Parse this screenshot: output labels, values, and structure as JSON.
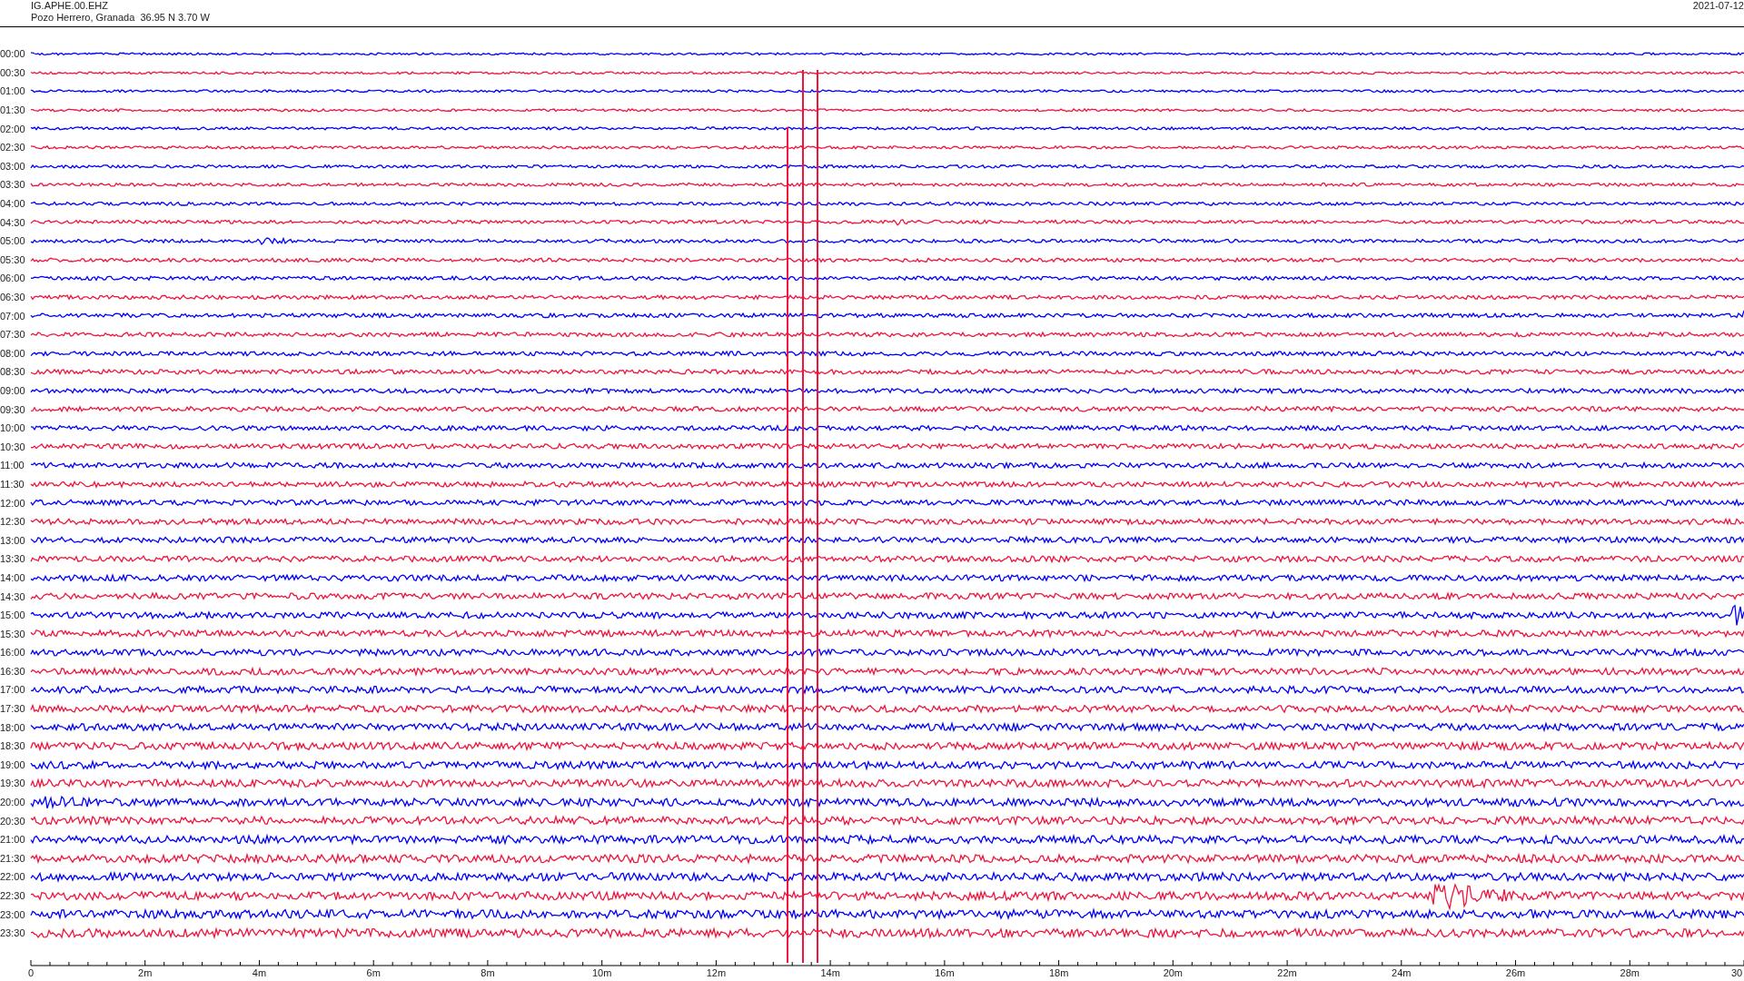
{
  "header": {
    "station": "IG.APHE.00.EHZ",
    "location": "Pozo Herrero, Granada  36.95 N 3.70 W",
    "date": "2021-07-12"
  },
  "rows": [
    {
      "time": "00:00",
      "color": "#0000ff"
    },
    {
      "time": "00:30",
      "color": "#f0143c"
    },
    {
      "time": "01:00",
      "color": "#0000ff"
    },
    {
      "time": "01:30",
      "color": "#f0143c"
    },
    {
      "time": "02:00",
      "color": "#0000ff"
    },
    {
      "time": "02:30",
      "color": "#f0143c"
    },
    {
      "time": "03:00",
      "color": "#0000ff"
    },
    {
      "time": "03:30",
      "color": "#f0143c"
    },
    {
      "time": "04:00",
      "color": "#0000ff"
    },
    {
      "time": "04:30",
      "color": "#f0143c"
    },
    {
      "time": "05:00",
      "color": "#0000ff"
    },
    {
      "time": "05:30",
      "color": "#f0143c"
    },
    {
      "time": "06:00",
      "color": "#0000ff"
    },
    {
      "time": "06:30",
      "color": "#f0143c"
    },
    {
      "time": "07:00",
      "color": "#0000ff"
    },
    {
      "time": "07:30",
      "color": "#f0143c"
    },
    {
      "time": "08:00",
      "color": "#0000ff"
    },
    {
      "time": "08:30",
      "color": "#f0143c"
    },
    {
      "time": "09:00",
      "color": "#0000ff"
    },
    {
      "time": "09:30",
      "color": "#f0143c"
    },
    {
      "time": "10:00",
      "color": "#0000ff"
    },
    {
      "time": "10:30",
      "color": "#f0143c"
    },
    {
      "time": "11:00",
      "color": "#0000ff"
    },
    {
      "time": "11:30",
      "color": "#f0143c"
    },
    {
      "time": "12:00",
      "color": "#0000ff"
    },
    {
      "time": "12:30",
      "color": "#f0143c"
    },
    {
      "time": "13:00",
      "color": "#0000ff"
    },
    {
      "time": "13:30",
      "color": "#f0143c"
    },
    {
      "time": "14:00",
      "color": "#0000ff"
    },
    {
      "time": "14:30",
      "color": "#f0143c"
    },
    {
      "time": "15:00",
      "color": "#0000ff"
    },
    {
      "time": "15:30",
      "color": "#f0143c"
    },
    {
      "time": "16:00",
      "color": "#0000ff"
    },
    {
      "time": "16:30",
      "color": "#f0143c"
    },
    {
      "time": "17:00",
      "color": "#0000ff"
    },
    {
      "time": "17:30",
      "color": "#f0143c"
    },
    {
      "time": "18:00",
      "color": "#0000ff"
    },
    {
      "time": "18:30",
      "color": "#f0143c"
    },
    {
      "time": "19:00",
      "color": "#0000ff"
    },
    {
      "time": "19:30",
      "color": "#f0143c"
    },
    {
      "time": "20:00",
      "color": "#0000ff"
    },
    {
      "time": "20:30",
      "color": "#f0143c"
    },
    {
      "time": "21:00",
      "color": "#0000ff"
    },
    {
      "time": "21:30",
      "color": "#f0143c"
    },
    {
      "time": "22:00",
      "color": "#0000ff"
    },
    {
      "time": "22:30",
      "color": "#f0143c"
    },
    {
      "time": "23:00",
      "color": "#0000ff"
    },
    {
      "time": "23:30",
      "color": "#f0143c"
    }
  ],
  "axis": {
    "ticks": [
      "0",
      "2m",
      "4m",
      "6m",
      "8m",
      "10m",
      "12m",
      "14m",
      "16m",
      "18m",
      "20m",
      "22m",
      "24m",
      "26m",
      "28m",
      "30"
    ]
  }
}
